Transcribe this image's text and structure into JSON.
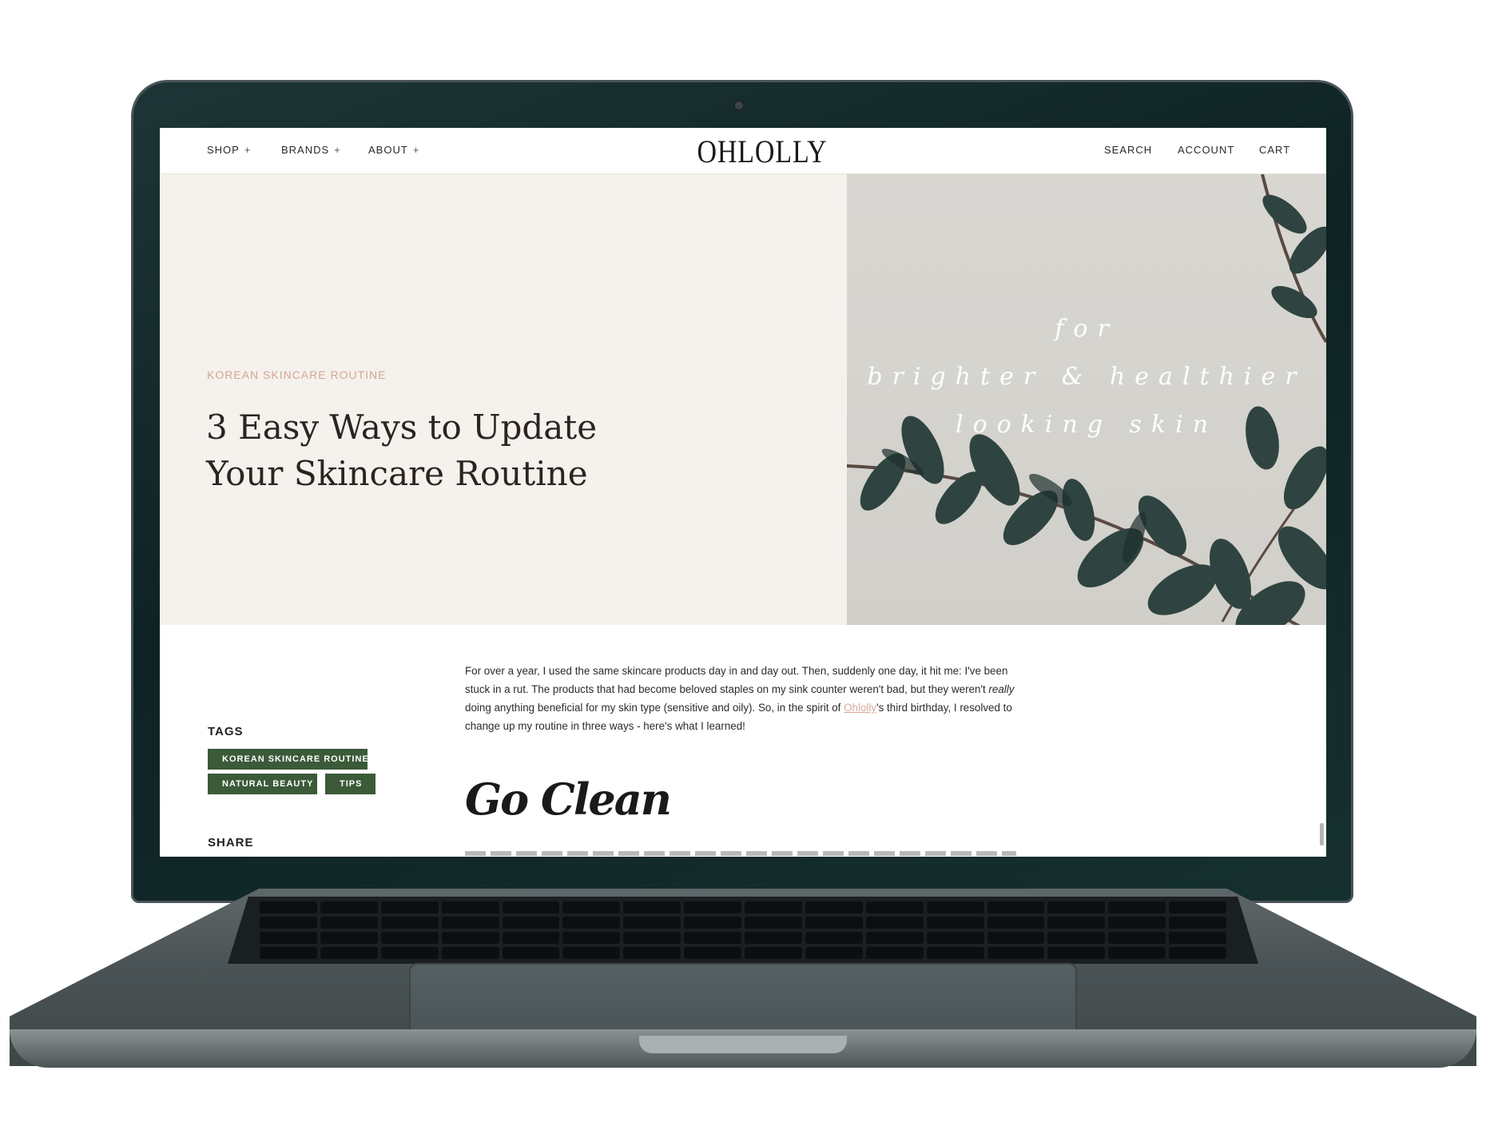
{
  "nav": {
    "left": [
      {
        "label": "SHOP",
        "icon": "plus-icon"
      },
      {
        "label": "BRANDS",
        "icon": "plus-icon"
      },
      {
        "label": "ABOUT",
        "icon": "plus-icon"
      }
    ],
    "plus_glyph": "+",
    "logo": "OHLOLLY",
    "right": [
      "SEARCH",
      "ACCOUNT",
      "CART"
    ]
  },
  "hero": {
    "eyebrow": "KOREAN SKINCARE ROUTINE",
    "title": "3 Easy Ways to Update Your Skincare Routine",
    "quote": [
      "for",
      "brighter & healthier",
      "looking skin"
    ]
  },
  "sidebar": {
    "tags_label": "TAGS",
    "tags": [
      "KOREAN SKINCARE ROUTINE",
      "NATURAL BEAUTY",
      "TIPS"
    ],
    "share_label": "SHARE"
  },
  "article": {
    "p1_a": "For over a year, I used the same skincare products day in and day out. Then, suddenly one day, it hit me: I've been stuck in a rut. The products that had become beloved staples on my sink counter weren't bad, but they weren't ",
    "p1_em": "really",
    "p1_b": " doing anything beneficial for my skin type (sensitive and oily). So, in the spirit of ",
    "p1_link": "Ohlolly",
    "p1_c": "'s third birthday, I resolved to change up my routine in three ways - here's what I learned!",
    "heading": "Go Clean"
  },
  "colors": {
    "accent_pink": "#d4a695",
    "tag_green": "#3b5a38",
    "hero_bg": "#f5f1ec",
    "laptop_lid": "#0e2223"
  }
}
